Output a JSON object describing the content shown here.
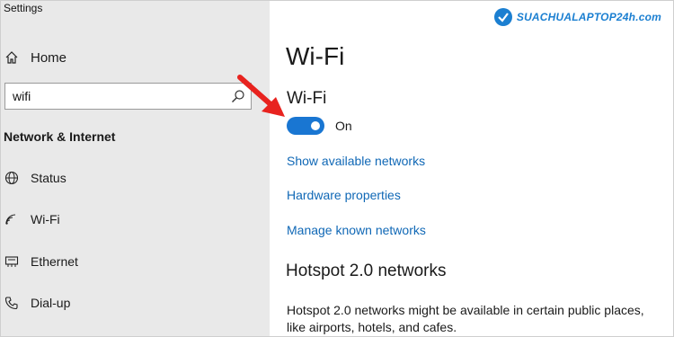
{
  "window": {
    "title": "Settings"
  },
  "sidebar": {
    "home": {
      "label": "Home",
      "icon": "home-icon"
    },
    "search": {
      "value": "wifi",
      "icon": "search-icon"
    },
    "section_title": "Network & Internet",
    "items": [
      {
        "label": "Status",
        "icon": "globe-icon"
      },
      {
        "label": "Wi-Fi",
        "icon": "wifi-icon"
      },
      {
        "label": "Ethernet",
        "icon": "ethernet-icon"
      },
      {
        "label": "Dial-up",
        "icon": "phone-icon"
      }
    ]
  },
  "main": {
    "page_title": "Wi-Fi",
    "wifi_section": {
      "label": "Wi-Fi",
      "toggle_state": "On",
      "toggle_on": true
    },
    "links": [
      "Show available networks",
      "Hardware properties",
      "Manage known networks"
    ],
    "hotspot": {
      "title": "Hotspot 2.0 networks",
      "description": "Hotspot 2.0 networks might be available in certain public places, like airports, hotels, and cafes."
    }
  },
  "watermark": {
    "text": "SUACHUALAPTOP24h.com"
  },
  "colors": {
    "accent": "#1976d2",
    "link": "#1068b6",
    "sidebar_bg": "#e9e9e9",
    "annotation_arrow": "#e8231f"
  }
}
